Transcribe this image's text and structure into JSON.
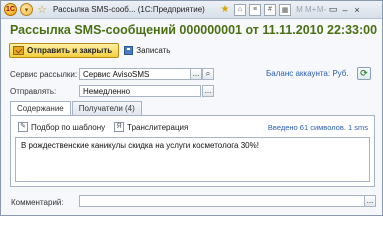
{
  "window": {
    "title": "Рассылка SMS-сооб... (1С:Предприятие)",
    "title_icons": [
      "star-icon",
      "home-icon",
      "document-icon",
      "calculator-icon",
      "calendar-icon"
    ],
    "letters": [
      "M",
      "M+",
      "M-"
    ],
    "controls": [
      "▭",
      "–",
      "×"
    ]
  },
  "header": {
    "title": "Рассылка SMS-сообщений 000000001 от 11.11.2010 22:33:00"
  },
  "toolbar": {
    "send_label": "Отправить и закрыть",
    "save_label": "Записать"
  },
  "form": {
    "service_label": "Сервис рассылки:",
    "service_value": "Сервис AvisoSMS",
    "service_more": "...",
    "sender_label": "Отправлять:",
    "sender_value": "Немедленно",
    "sender_more": "...",
    "balance_label": "Баланс аккаунта: Руб."
  },
  "tabs": [
    {
      "label": "Содержание",
      "active": true
    },
    {
      "label": "Получатели (4)",
      "active": false
    }
  ],
  "content": {
    "template_label": "Подбор по шаблону",
    "translit_label": "Транслитерация",
    "counter": "Введено 61 символов. 1 sms",
    "message": "В рождественские каникулы скидка на услуги косметолога 30%!"
  },
  "comment": {
    "label": "Комментарий:",
    "value": "",
    "more": "..."
  },
  "colors": {
    "title_green": "#4a7012",
    "link_blue": "#2d5fb3",
    "send_button": "#f4cf3d"
  }
}
